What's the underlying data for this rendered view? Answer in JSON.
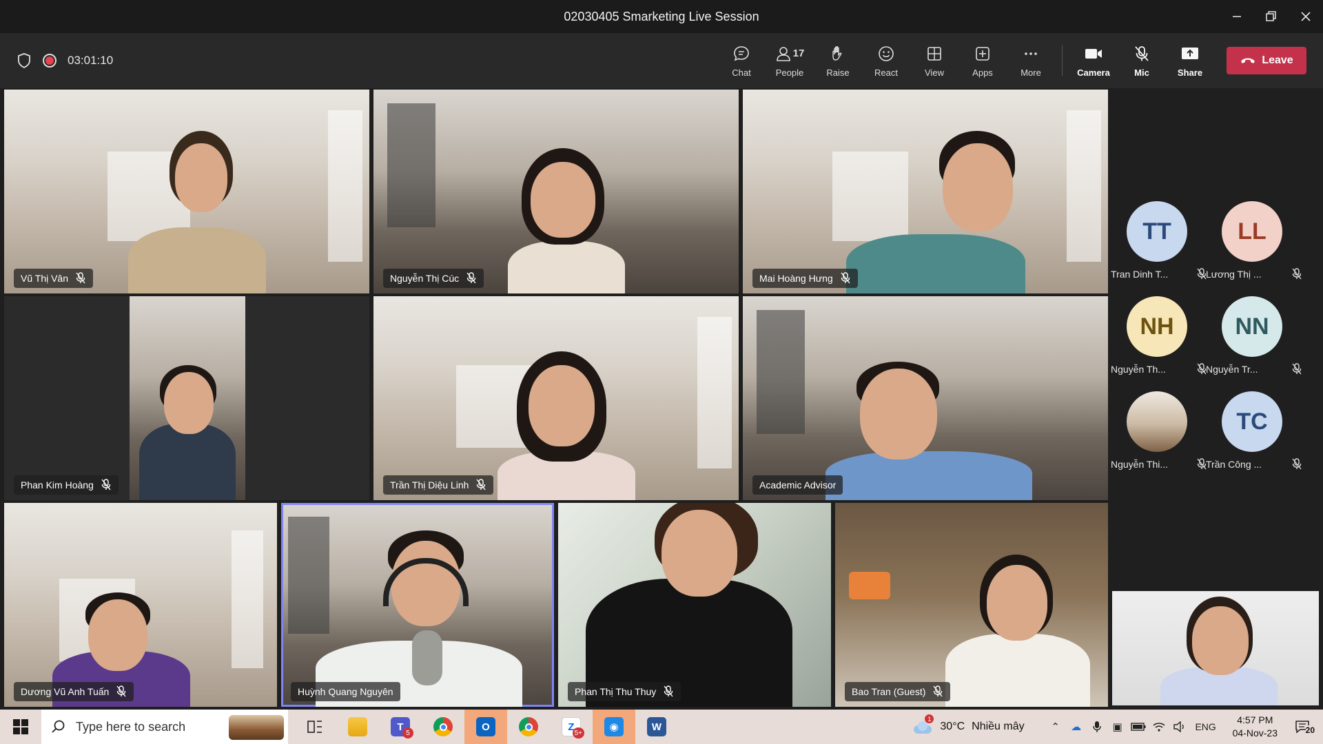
{
  "window": {
    "title": "02030405 Smarketing Live Session",
    "minimize_icon": "minimize-icon",
    "restore_icon": "restore-icon",
    "close_icon": "close-icon"
  },
  "toolbar": {
    "timer": "03:01:10",
    "chat_label": "Chat",
    "people_label": "People",
    "people_count": "17",
    "raise_label": "Raise",
    "react_label": "React",
    "view_label": "View",
    "apps_label": "Apps",
    "more_label": "More",
    "camera_label": "Camera",
    "mic_label": "Mic",
    "share_label": "Share",
    "leave_label": "Leave",
    "leave_color": "#c4314b"
  },
  "tiles": {
    "t1": "Vũ Thị Vân",
    "t2": "Nguyễn Thị Cúc",
    "t3": "Mai Hoàng Hưng",
    "t4": "Phan Kim Hoàng",
    "t5": "Trần Thị Diệu Linh",
    "t6": "Academic Advisor",
    "t7": "Dương Vũ Anh Tuấn",
    "t8": "Huỳnh Quang Nguyên",
    "t9": "Phan Thị Thu Thuy",
    "t10": "Bao Tran (Guest)"
  },
  "roster": [
    {
      "initials": "TT",
      "name": "Tran Dinh T...",
      "color": "#c7d8ef",
      "text_color": "#2b4a7a"
    },
    {
      "initials": "LL",
      "name": "Lương Thị ...",
      "color": "#f2d2c8",
      "text_color": "#9a3b26"
    },
    {
      "initials": "NH",
      "name": "Nguyễn Th...",
      "color": "#f7e6b8",
      "text_color": "#6d5210"
    },
    {
      "initials": "NN",
      "name": "Nguyễn Tr...",
      "color": "#d6e9ea",
      "text_color": "#2e5a5e"
    },
    {
      "initials": "",
      "name": "Nguyễn Thi...",
      "color": "#b59a7c",
      "text_color": "#ffffff"
    },
    {
      "initials": "TC",
      "name": "Trần Công ...",
      "color": "#c7d8ef",
      "text_color": "#2b4a7a"
    }
  ],
  "taskbar": {
    "search_placeholder": "Type here to search",
    "teams_badge": "5",
    "zalo_badge": "5+",
    "weather_alert": "1",
    "temperature": "30°C",
    "weather_desc": "Nhiều mây",
    "language": "ENG",
    "time": "4:57 PM",
    "date": "04-Nov-23",
    "notifications": "20"
  }
}
